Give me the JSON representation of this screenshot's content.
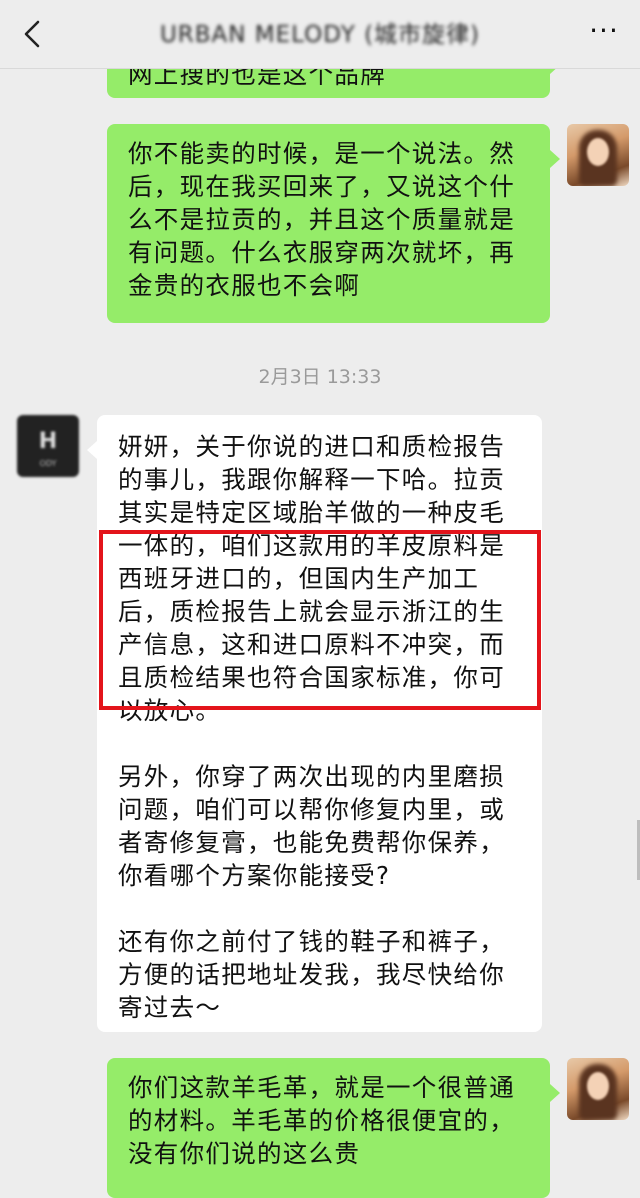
{
  "header": {
    "title": "URBAN MELODY (城市旋律)",
    "back_icon": "chevron-left-icon",
    "more_label": "···"
  },
  "messages": [
    {
      "side": "right",
      "text": "网上搜的也是这个品牌"
    },
    {
      "side": "right",
      "text": "你不能卖的时候，是一个说法。然后，现在我买回来了，又说这个什么不是拉贡的，并且这个质量就是有问题。什么衣服穿两次就坏，再金贵的衣服也不会啊"
    },
    {
      "side": "left",
      "paragraphs": [
        "妍妍，关于你说的进口和质检报告的事儿，我跟你解释一下哈。拉贡其实是特定区域胎羊做的一种皮毛一体的，咱们这款用的羊皮原料是西班牙进口的，但国内生产加工后，质检报告上就会显示浙江的生产信息，这和进口原料不冲突，而且质检结果也符合国家标准，你可以放心。",
        "另外，你穿了两次出现的内里磨损问题，咱们可以帮你修复内里，或者寄修复膏，也能免费帮你保养，你看哪个方案你能接受?",
        "还有你之前付了钱的鞋子和裤子，方便的话把地址发我，我尽快给你寄过去～"
      ]
    },
    {
      "side": "right",
      "text": "你们这款羊毛革，就是一个很普通的材料。羊毛革的价格很便宜的，没有你们说的这么贵"
    }
  ],
  "timestamp": "2月3日 13:33",
  "shop_avatar_text": "ODY",
  "colors": {
    "sent_bubble": "#95ec69",
    "received_bubble": "#ffffff",
    "background": "#ededed",
    "highlight_box": "#e3141b"
  }
}
